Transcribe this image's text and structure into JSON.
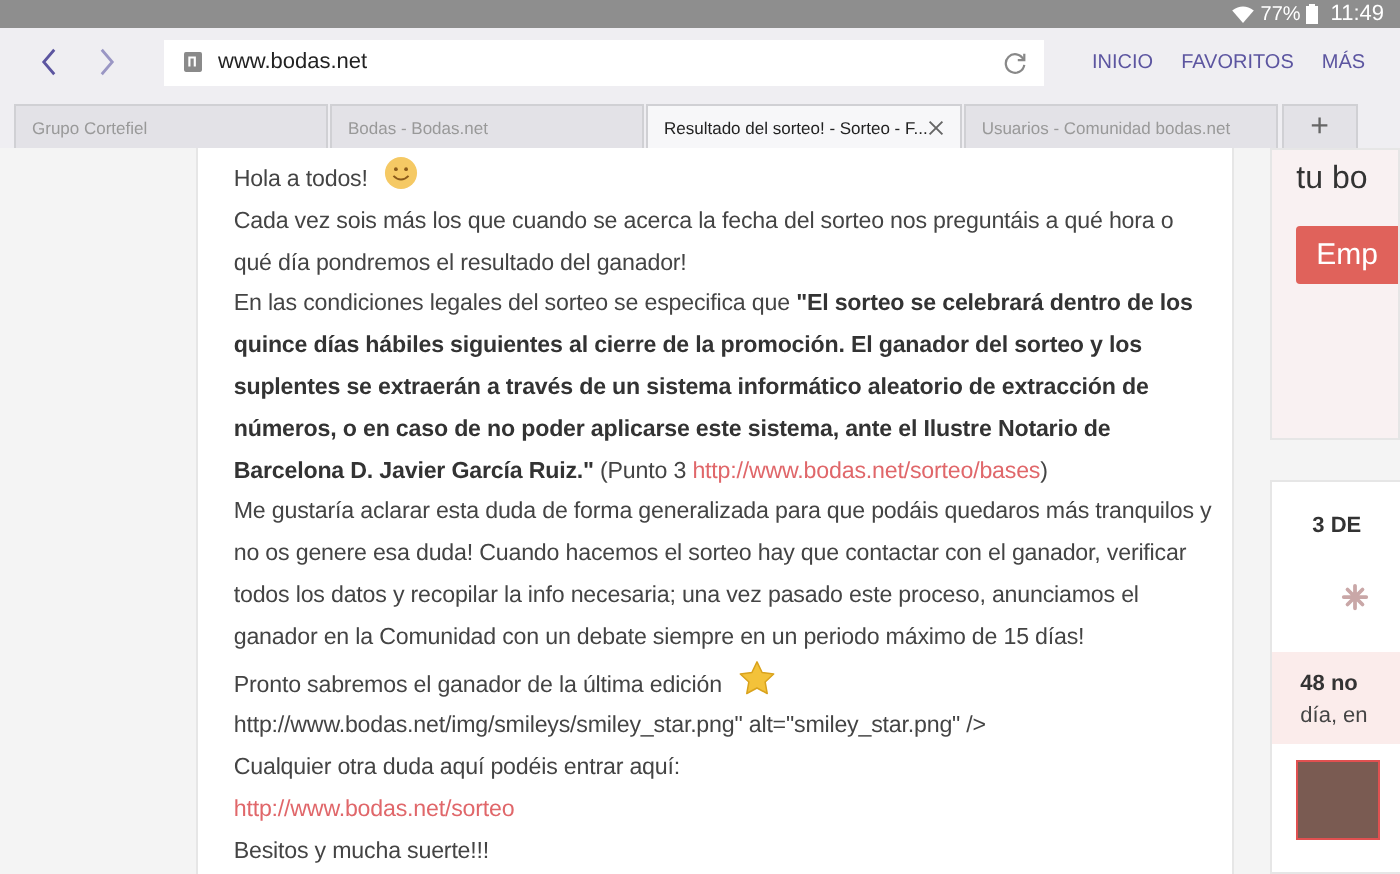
{
  "status_bar": {
    "battery": "77%",
    "time": "11:49"
  },
  "toolbar": {
    "url": "www.bodas.net",
    "links": [
      "INICIO",
      "FAVORITOS",
      "MÁS"
    ]
  },
  "tabs": [
    {
      "label": "Grupo Cortefiel",
      "selected": false
    },
    {
      "label": "Bodas - Bodas.net",
      "selected": false
    },
    {
      "label": "Resultado del sorteo! - Sorteo - F...",
      "selected": true
    },
    {
      "label": "Usuarios - Comunidad bodas.net",
      "selected": false
    }
  ],
  "new_tab": "+",
  "post": [
    [
      {
        "kind": "text",
        "text": "Hola a todos!"
      },
      {
        "kind": "smiley"
      }
    ],
    [
      {
        "kind": "text",
        "text": "Cada vez sois más los que cuando se acerca la fecha del sorteo nos preguntáis a qué hora o qué día pondremos el resultado del ganador!"
      }
    ],
    [
      {
        "kind": "text",
        "text": "En las condiciones legales del sorteo se especifica que **\"El sorteo se celebrará dentro de los quince días hábiles siguientes al cierre de la promoción. El ganador del sorteo y los suplentes se extraerán a través de un sistema informático aleatorio de extracción de números, o en caso de no poder aplicarse este sistema, ante el Ilustre Notario de Barcelona D. Javier García Ruiz.\"** (Punto 3 "
      },
      {
        "kind": "link",
        "text": "http://www.bodas.net/sorteo/bases"
      },
      {
        "kind": "text",
        "text": ")"
      }
    ],
    [
      {
        "kind": "text",
        "text": "Me gustaría aclarar esta duda de forma generalizada para que podáis quedaros más tranquilos y no os genere esa duda! Cuando hacemos el sorteo hay que contactar con el ganador, verificar todos los datos y recopilar la info necesaria; una vez pasado este proceso, anunciamos el ganador en la Comunidad con un debate siempre en un periodo máximo de 15 días!"
      }
    ],
    [
      {
        "kind": "text",
        "text": "Pronto sabremos el ganador de la última edición"
      },
      {
        "kind": "star"
      }
    ],
    [
      {
        "kind": "text",
        "text": "http://www.bodas.net/img/smileys/smiley_star.png\" alt=\"smiley_star.png\" />"
      }
    ],
    [
      {
        "kind": "text",
        "text": "Cualquier otra duda aquí podéis entrar aquí:"
      }
    ],
    [
      {
        "kind": "link",
        "text": "http://www.bodas.net/sorteo"
      }
    ],
    [
      {
        "kind": "text",
        "text": "Besitos y mucha suerte!!!"
      }
    ]
  ],
  "sidebar": {
    "banner_text": "tu bo",
    "banner_button": "Emp",
    "card_title": "3 DE",
    "band_title": "48 no",
    "band_text": "día, en"
  }
}
